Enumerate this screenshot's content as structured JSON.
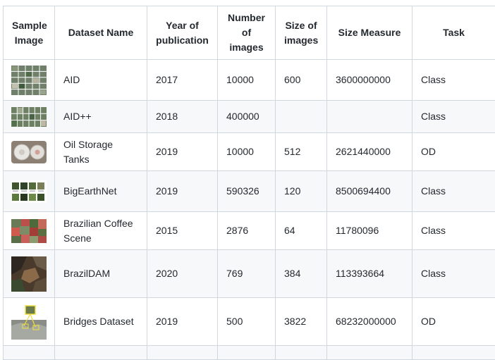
{
  "headers": {
    "sample_image": "Sample Image",
    "dataset_name": "Dataset Name",
    "year": "Year of publication",
    "num_images": "Number of images",
    "size_images": "Size of images",
    "size_measure": "Size Measure",
    "task": "Task"
  },
  "rows": [
    {
      "name": "AID",
      "year": "2017",
      "num_images": "10000",
      "size": "600",
      "measure": "3600000000",
      "task": "Class",
      "thumb": "aid-grid-thumbnail"
    },
    {
      "name": "AID++",
      "year": "2018",
      "num_images": "400000",
      "size": "",
      "measure": "",
      "task": "Class",
      "thumb": "aid-plus-grid-thumbnail"
    },
    {
      "name": "Oil Storage Tanks",
      "year": "2019",
      "num_images": "10000",
      "size": "512",
      "measure": "2621440000",
      "task": "OD",
      "thumb": "oil-tanks-thumbnail"
    },
    {
      "name": "BigEarthNet",
      "year": "2019",
      "num_images": "590326",
      "size": "120",
      "measure": "8500694400",
      "task": "Class",
      "thumb": "bigearthnet-thumbnail"
    },
    {
      "name": "Brazilian Coffee Scene",
      "year": "2015",
      "num_images": "2876",
      "size": "64",
      "measure": "11780096",
      "task": "Class",
      "thumb": "coffee-scene-thumbnail"
    },
    {
      "name": "BrazilDAM",
      "year": "2020",
      "num_images": "769",
      "size": "384",
      "measure": "113393664",
      "task": "Class",
      "thumb": "brazildam-thumbnail"
    },
    {
      "name": "Bridges Dataset",
      "year": "2019",
      "num_images": "500",
      "size": "3822",
      "measure": "68232000000",
      "task": "OD",
      "thumb": "bridges-thumbnail"
    }
  ]
}
